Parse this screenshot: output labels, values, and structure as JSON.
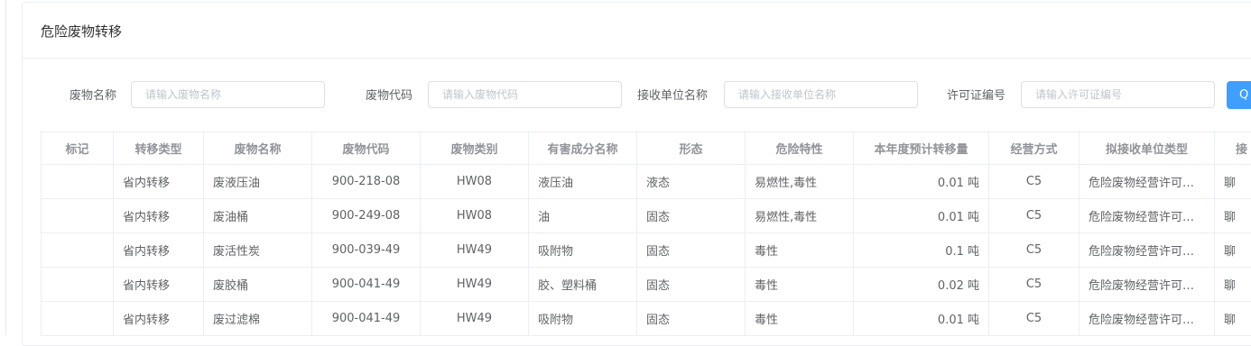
{
  "card": {
    "title": "危险废物转移"
  },
  "search": {
    "fields": [
      {
        "label": "废物名称",
        "placeholder": "请输入废物名称"
      },
      {
        "label": "废物代码",
        "placeholder": "请输入废物代码"
      },
      {
        "label": "接收单位名称",
        "placeholder": "请输入接收单位名称"
      },
      {
        "label": "许可证编号",
        "placeholder": "请输入许可证编号"
      }
    ],
    "button_label": "Q"
  },
  "table": {
    "columns": [
      "标记",
      "转移类型",
      "废物名称",
      "废物代码",
      "废物类别",
      "有害成分名称",
      "形态",
      "危险特性",
      "本年度预计转移量",
      "经营方式",
      "拟接收单位类型",
      "接"
    ],
    "rows": [
      [
        "",
        "省内转移",
        "废液压油",
        "900-218-08",
        "HW08",
        "液压油",
        "液态",
        "易燃性,毒性",
        "0.01 吨",
        "C5",
        "危险废物经营许可…",
        "聊"
      ],
      [
        "",
        "省内转移",
        "废油桶",
        "900-249-08",
        "HW08",
        "油",
        "固态",
        "易燃性,毒性",
        "0.01 吨",
        "C5",
        "危险废物经营许可…",
        "聊"
      ],
      [
        "",
        "省内转移",
        "废活性炭",
        "900-039-49",
        "HW49",
        "吸附物",
        "固态",
        "毒性",
        "0.1 吨",
        "C5",
        "危险废物经营许可…",
        "聊"
      ],
      [
        "",
        "省内转移",
        "废胶桶",
        "900-041-49",
        "HW49",
        "胶、塑料桶",
        "固态",
        "毒性",
        "0.02 吨",
        "C5",
        "危险废物经营许可…",
        "聊"
      ],
      [
        "",
        "省内转移",
        "废过滤棉",
        "900-041-49",
        "HW49",
        "吸附物",
        "固态",
        "毒性",
        "0.01 吨",
        "C5",
        "危险废物经营许可…",
        "聊"
      ]
    ]
  }
}
